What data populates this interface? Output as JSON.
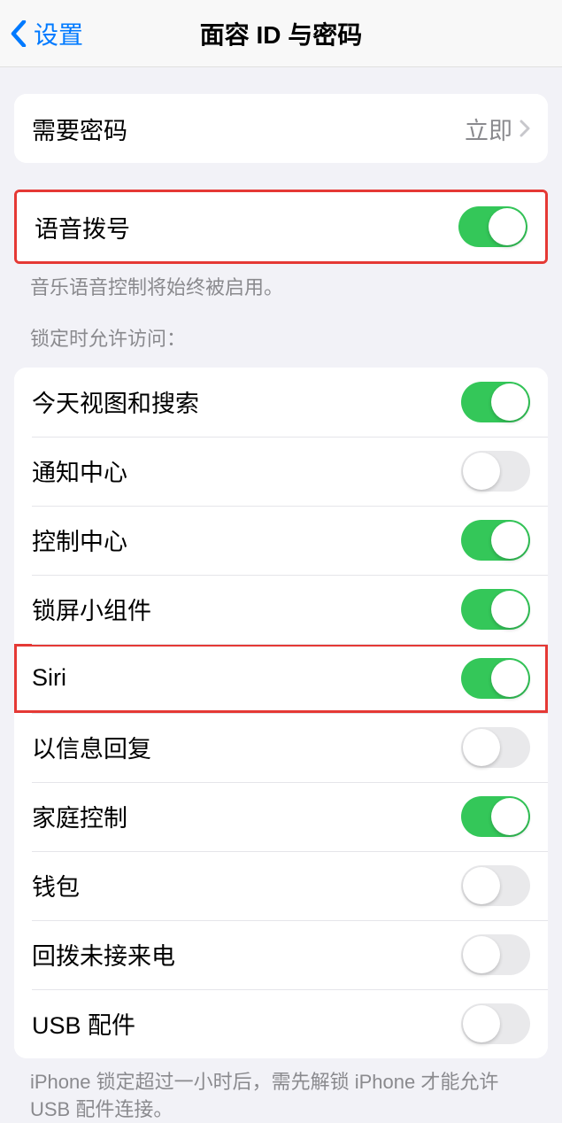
{
  "nav": {
    "back_label": "设置",
    "title": "面容 ID 与密码"
  },
  "require_passcode": {
    "label": "需要密码",
    "value": "立即"
  },
  "voice_dial": {
    "label": "语音拨号",
    "on": true,
    "footer": "音乐语音控制将始终被启用。"
  },
  "lock_access": {
    "header": "锁定时允许访问：",
    "items": [
      {
        "label": "今天视图和搜索",
        "on": true
      },
      {
        "label": "通知中心",
        "on": false
      },
      {
        "label": "控制中心",
        "on": true
      },
      {
        "label": "锁屏小组件",
        "on": true
      },
      {
        "label": "Siri",
        "on": true,
        "highlight": true
      },
      {
        "label": "以信息回复",
        "on": false
      },
      {
        "label": "家庭控制",
        "on": true
      },
      {
        "label": "钱包",
        "on": false
      },
      {
        "label": "回拨未接来电",
        "on": false
      },
      {
        "label": "USB 配件",
        "on": false
      }
    ],
    "footer": "iPhone 锁定超过一小时后，需先解锁 iPhone 才能允许 USB 配件连接。"
  }
}
